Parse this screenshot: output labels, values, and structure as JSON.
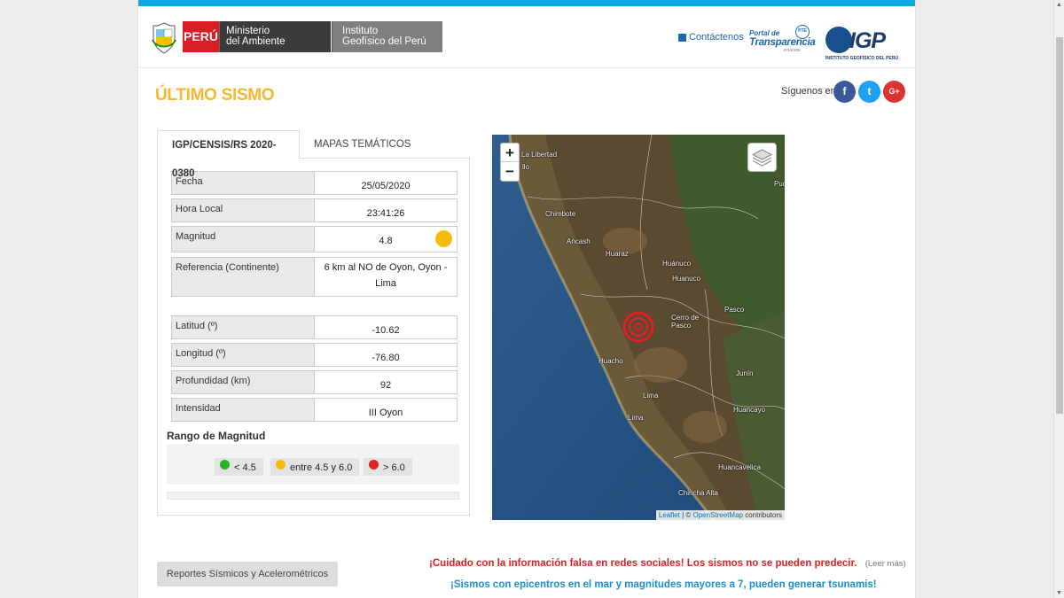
{
  "header": {
    "peru": "PERÚ",
    "ministerio": [
      "Ministerio",
      "del Ambiente"
    ],
    "instituto": [
      "Instituto",
      "Geofísico del Perú"
    ],
    "contact": "Contáctenos",
    "transparencia": [
      "Portal de",
      "Transparencia",
      "estándar"
    ],
    "pte": "PTE",
    "igp_logo": "IGP",
    "igp_sub": "INSTITUTO GEOFÍSICO DEL PERÚ"
  },
  "title": "ÚLTIMO SISMO",
  "social": {
    "label": "Síguenos en:",
    "items": [
      {
        "icon": "facebook-icon",
        "glyph": "f",
        "color": "#3b5998"
      },
      {
        "icon": "twitter-icon",
        "glyph": "t",
        "color": "#1da1f2"
      },
      {
        "icon": "google-plus-icon",
        "glyph": "G+",
        "color": "#e03131"
      }
    ]
  },
  "tabs": [
    {
      "label": "IGP/CENSIS/RS  2020-0380",
      "active": true
    },
    {
      "label": "MAPAS TEMÁTICOS",
      "active": false
    }
  ],
  "sismo": {
    "fecha": {
      "label": "Fecha",
      "value": "25/05/2020"
    },
    "hora": {
      "label": "Hora Local",
      "value": "23:41:26"
    },
    "magnitud": {
      "label": "Magnitud",
      "value": "4.8",
      "indicator_color": "#f7bb0e"
    },
    "referencia": {
      "label": "Referencia (Continente)",
      "value": "6 km al NO de Oyon, Oyon - Lima"
    },
    "latitud": {
      "label": "Latitud (º)",
      "value": "-10.62"
    },
    "longitud": {
      "label": "Longitud (º)",
      "value": "-76.80"
    },
    "profundidad": {
      "label": "Profundidad (km)",
      "value": "92"
    },
    "intensidad": {
      "label": "Intensidad",
      "value": "III Oyon"
    }
  },
  "rango": {
    "title": "Rango de Magnitud",
    "items": [
      {
        "label": "< 4.5",
        "color": "#22b51f"
      },
      {
        "label": "entre 4.5 y 6.0",
        "color": "#f7bb0e"
      },
      {
        "label": "> 6.0",
        "color": "#e02424"
      }
    ]
  },
  "map": {
    "zoom_in": "+",
    "zoom_out": "−",
    "attribution": {
      "leaflet": "Leaflet",
      "sep": " | © ",
      "osm": "OpenStreetMap",
      "rest": " contributors"
    },
    "cities": [
      "La Libertad",
      "Chimbote",
      "Ancash",
      "Huaraz",
      "Huánuco",
      "Huanuco",
      "Pasco",
      "Cerro de Pasco",
      "Huacho",
      "Lima",
      "Lima",
      "Junín",
      "Huancayo",
      "Huancavelica",
      "Chincha Alta",
      "Puc",
      "llo"
    ]
  },
  "footer": {
    "button": "Reportes Sísmicos y Acelerométricos",
    "warning": "¡Cuidado con la información falsa en redes sociales! Los sismos no se pueden predecir.",
    "leer_mas": "(Leer más)",
    "tsunami": "¡Sismos con epicentros en el mar y magnitudes mayores a 7, pueden generar tsunamis!"
  }
}
